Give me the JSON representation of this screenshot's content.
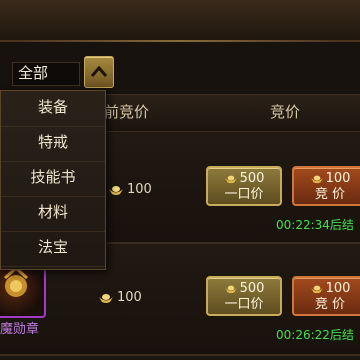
{
  "filter": {
    "selected": "全部"
  },
  "dropdown": {
    "items": [
      "装备",
      "特戒",
      "技能书",
      "材料",
      "法宝"
    ]
  },
  "table": {
    "headers": {
      "current_price": "前竞价",
      "bid": "竞价"
    }
  },
  "rows": [
    {
      "price": "100",
      "buy_amount": "500",
      "buy_label": "一口价",
      "bid_amount": "100",
      "bid_label": "竞 价",
      "timer": "00:22:34后结"
    },
    {
      "item_name": "魔勋章",
      "price": "100",
      "buy_amount": "500",
      "buy_label": "一口价",
      "bid_amount": "100",
      "bid_label": "竞 价",
      "timer": "00:26:22后结"
    }
  ],
  "colors": {
    "timer": "#44e04a",
    "item_rarity": "#a23cc8",
    "gold_button": "#8e7a3c",
    "bid_button": "#a34a1e"
  },
  "icons": [
    "gold-ingot-icon",
    "chevron-up-icon",
    "item-medal-icon"
  ]
}
